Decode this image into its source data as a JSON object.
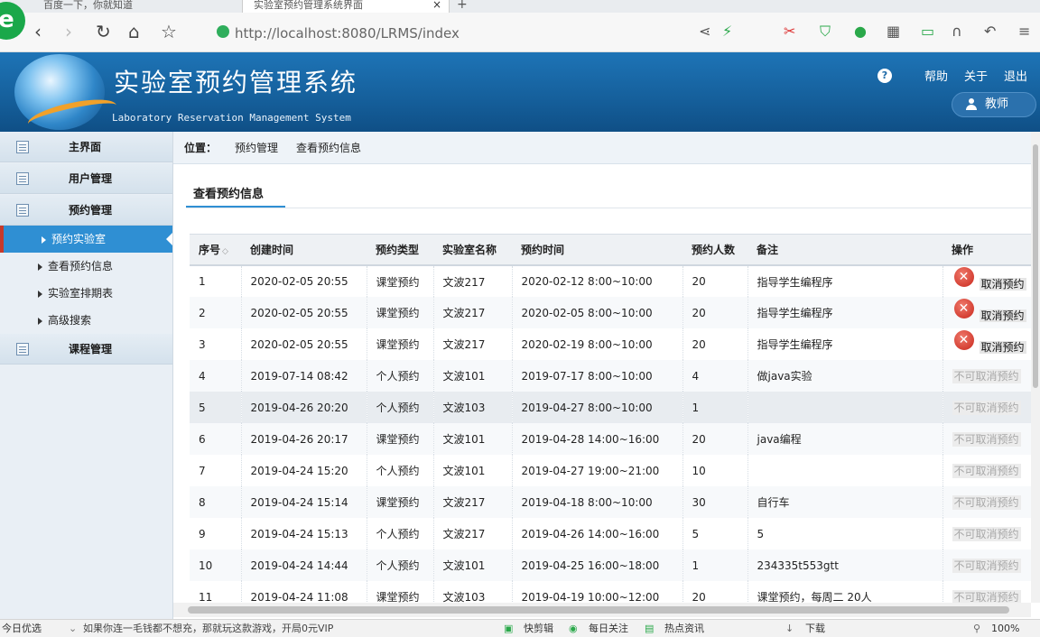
{
  "browser": {
    "tabs": [
      {
        "title": "百度一下，你就知道"
      },
      {
        "title": "实验室预约管理系统界面"
      }
    ],
    "new_tab": "+",
    "close": "×",
    "url": "http://localhost:8080/LRMS/index"
  },
  "header": {
    "title": "实验室预约管理系统",
    "subtitle": "Laboratory Reservation Management System",
    "help_mark": "?",
    "links": [
      "帮助",
      "关于",
      "退出"
    ],
    "role": "教师"
  },
  "sidebar": {
    "groups": [
      {
        "label": "主界面"
      },
      {
        "label": "用户管理"
      },
      {
        "label": "预约管理"
      },
      {
        "label": "课程管理"
      }
    ],
    "sub_items": [
      {
        "label": "预约实验室",
        "active": true
      },
      {
        "label": "查看预约信息",
        "active": false
      },
      {
        "label": "实验室排期表",
        "active": false
      },
      {
        "label": "高级搜索",
        "active": false
      }
    ]
  },
  "breadcrumb": {
    "prefix": "位置：",
    "items": [
      "预约管理",
      "查看预约信息"
    ]
  },
  "section_title": "查看预约信息",
  "table": {
    "columns": [
      "序号",
      "创建时间",
      "预约类型",
      "实验室名称",
      "预约时间",
      "预约人数",
      "备注",
      "操作"
    ],
    "sort_mark": "◇",
    "rows": [
      {
        "id": "1",
        "created": "2020-02-05 20:55",
        "type": "课堂预约",
        "lab": "文波217",
        "time": "2020-02-12 8:00~10:00",
        "count": "20",
        "note": "指导学生编程序",
        "action": "取消预约",
        "cancelable": true
      },
      {
        "id": "2",
        "created": "2020-02-05 20:55",
        "type": "课堂预约",
        "lab": "文波217",
        "time": "2020-02-05 8:00~10:00",
        "count": "20",
        "note": "指导学生编程序",
        "action": "取消预约",
        "cancelable": true
      },
      {
        "id": "3",
        "created": "2020-02-05 20:55",
        "type": "课堂预约",
        "lab": "文波217",
        "time": "2020-02-19 8:00~10:00",
        "count": "20",
        "note": "指导学生编程序",
        "action": "取消预约",
        "cancelable": true
      },
      {
        "id": "4",
        "created": "2019-07-14 08:42",
        "type": "个人预约",
        "lab": "文波101",
        "time": "2019-07-17 8:00~10:00",
        "count": "4",
        "note": "做java实验",
        "action": "不可取消预约",
        "cancelable": false
      },
      {
        "id": "5",
        "created": "2019-04-26 20:20",
        "type": "个人预约",
        "lab": "文波103",
        "time": "2019-04-27 8:00~10:00",
        "count": "1",
        "note": "",
        "action": "不可取消预约",
        "cancelable": false
      },
      {
        "id": "6",
        "created": "2019-04-26 20:17",
        "type": "课堂预约",
        "lab": "文波101",
        "time": "2019-04-28 14:00~16:00",
        "count": "20",
        "note": "java编程",
        "action": "不可取消预约",
        "cancelable": false
      },
      {
        "id": "7",
        "created": "2019-04-24 15:20",
        "type": "个人预约",
        "lab": "文波101",
        "time": "2019-04-27 19:00~21:00",
        "count": "10",
        "note": "",
        "action": "不可取消预约",
        "cancelable": false
      },
      {
        "id": "8",
        "created": "2019-04-24 15:14",
        "type": "课堂预约",
        "lab": "文波217",
        "time": "2019-04-18 8:00~10:00",
        "count": "30",
        "note": "自行车",
        "action": "不可取消预约",
        "cancelable": false
      },
      {
        "id": "9",
        "created": "2019-04-24 15:13",
        "type": "个人预约",
        "lab": "文波217",
        "time": "2019-04-26 14:00~16:00",
        "count": "5",
        "note": "5",
        "action": "不可取消预约",
        "cancelable": false
      },
      {
        "id": "10",
        "created": "2019-04-24 14:44",
        "type": "个人预约",
        "lab": "文波101",
        "time": "2019-04-25 16:00~18:00",
        "count": "1",
        "note": "234335t553gtt",
        "action": "不可取消预约",
        "cancelable": false
      },
      {
        "id": "11",
        "created": "2019-04-24 11:08",
        "type": "课堂预约",
        "lab": "文波103",
        "time": "2019-04-19 10:00~12:00",
        "count": "20",
        "note": "课堂预约，每周二 20人",
        "action": "不可取消预约",
        "cancelable": false
      }
    ]
  },
  "statusbar": {
    "left": "今日优选",
    "ticker": "如果你连一毛钱都不想充，那就玩这款游戏，开局0元VIP",
    "items": [
      "快剪辑",
      "每日关注",
      "热点资讯",
      "下载"
    ],
    "zoom": "100%"
  },
  "colors": {
    "header_blue": "#1e74b6",
    "active_menu": "#2f8fd3",
    "cancel_red": "#c8261b"
  }
}
